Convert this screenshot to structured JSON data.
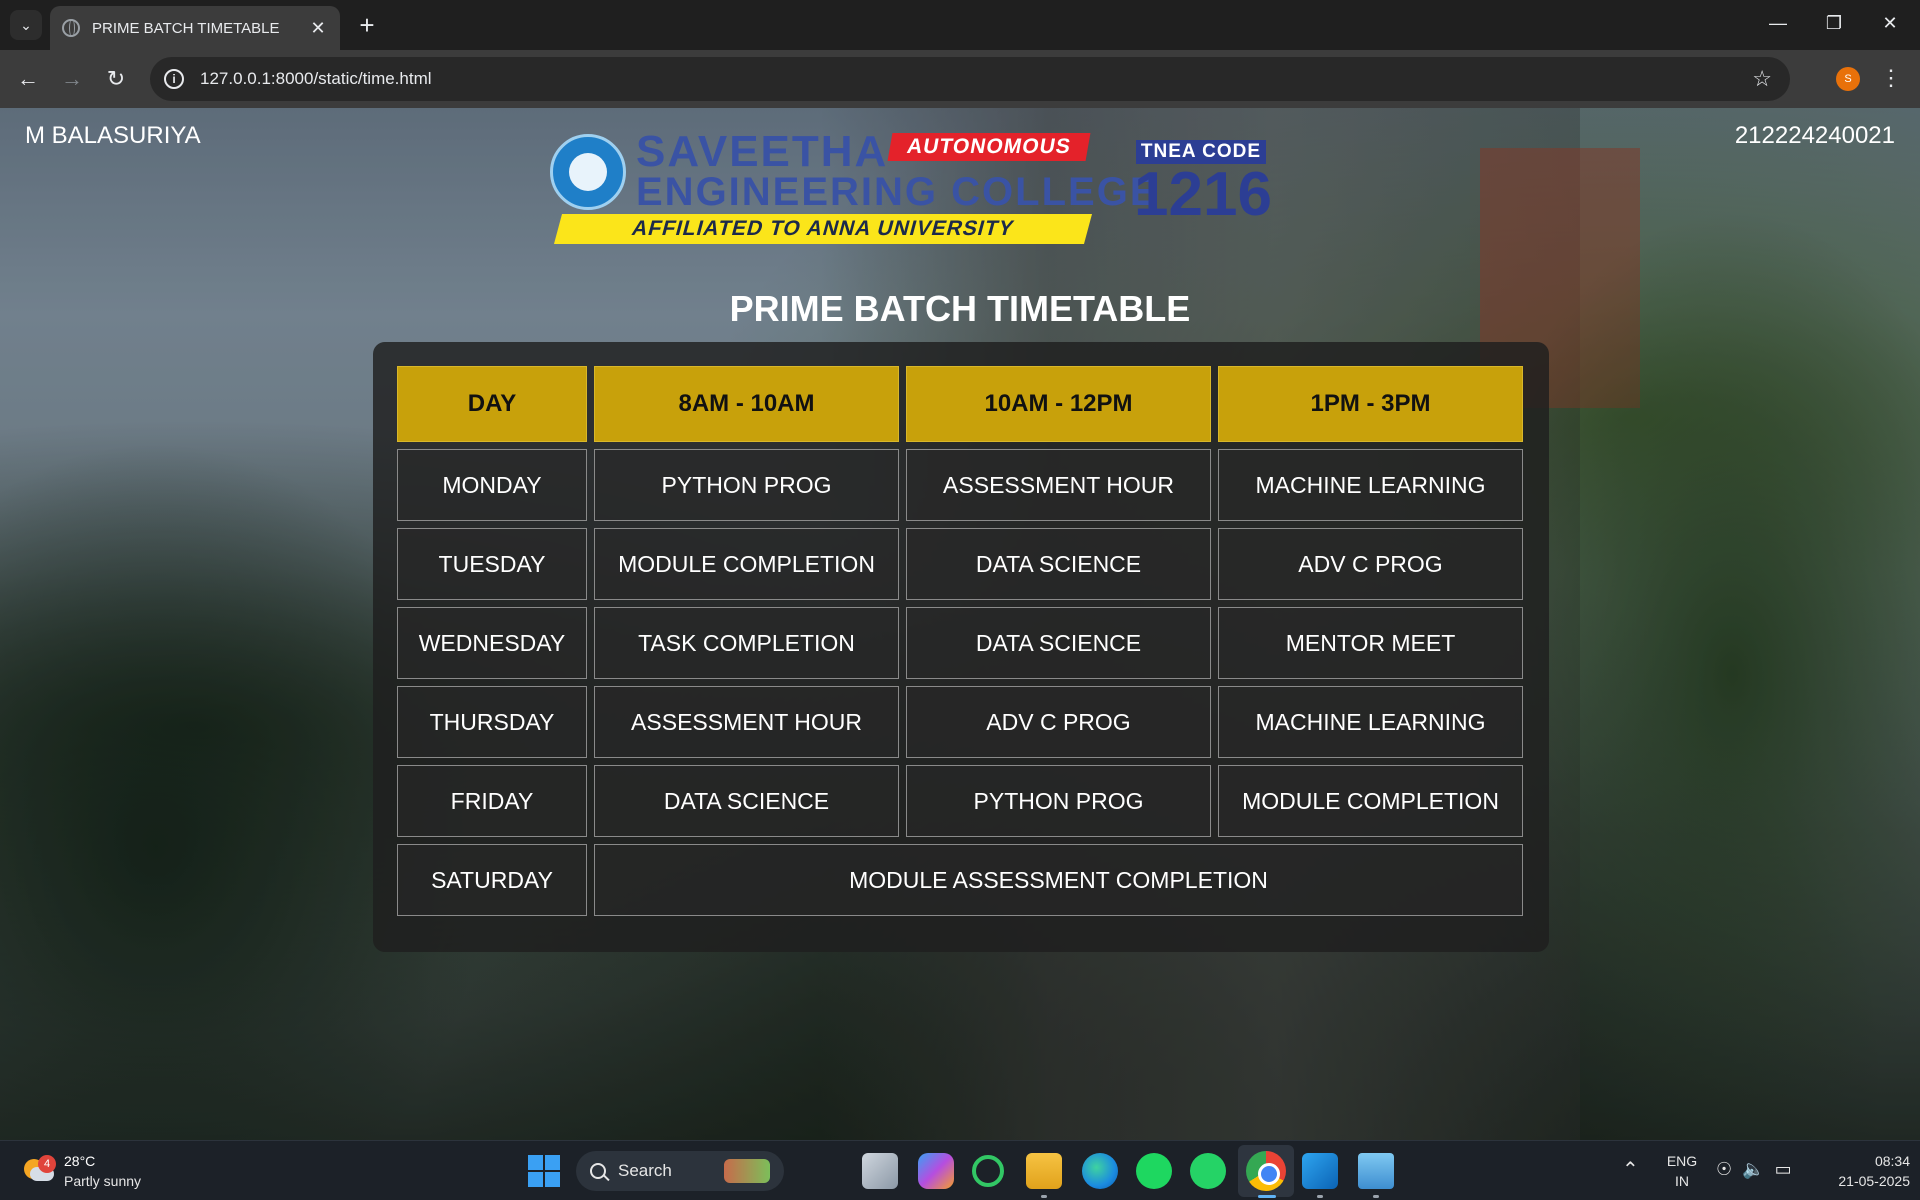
{
  "browser": {
    "tab_title": "PRIME BATCH TIMETABLE",
    "tab_close": "✕",
    "new_tab": "+",
    "url": "127.0.0.1:8000/static/time.html",
    "profile_initial": "S"
  },
  "page": {
    "student_name": "M BALASURIYA",
    "student_id": "212224240021",
    "logo": {
      "line1": "SAVEETHA",
      "autonomous": "AUTONOMOUS",
      "line2": "ENGINEERING COLLEGE",
      "affiliated": "AFFILIATED TO ANNA UNIVERSITY",
      "tnea_label": "TNEA CODE",
      "tnea_code": "1216"
    },
    "title": "PRIME BATCH TIMETABLE",
    "timetable": {
      "headers": [
        "DAY",
        "8AM - 10AM",
        "10AM - 12PM",
        "1PM - 3PM"
      ],
      "rows": [
        {
          "day": "MONDAY",
          "slots": [
            "PYTHON PROG",
            "ASSESSMENT HOUR",
            "MACHINE LEARNING"
          ]
        },
        {
          "day": "TUESDAY",
          "slots": [
            "MODULE COMPLETION",
            "DATA SCIENCE",
            "ADV C PROG"
          ]
        },
        {
          "day": "WEDNESDAY",
          "slots": [
            "TASK COMPLETION",
            "DATA SCIENCE",
            "MENTOR MEET"
          ]
        },
        {
          "day": "THURSDAY",
          "slots": [
            "ASSESSMENT HOUR",
            "ADV C PROG",
            "MACHINE LEARNING"
          ]
        },
        {
          "day": "FRIDAY",
          "slots": [
            "DATA SCIENCE",
            "PYTHON PROG",
            "MODULE COMPLETION"
          ]
        },
        {
          "day": "SATURDAY",
          "slots": [
            "MODULE ASSESSMENT COMPLETION"
          ]
        }
      ]
    }
  },
  "taskbar": {
    "weather_badge": "4",
    "weather_temp": "28°C",
    "weather_desc": "Partly sunny",
    "search_label": "Search",
    "lang_line1": "ENG",
    "lang_line2": "IN",
    "time": "08:34",
    "date": "21-05-2025"
  },
  "colors": {
    "header_gold": "#c8a10b",
    "logo_blue": "#3a53a4",
    "autonomous_red": "#e4222a",
    "affiliated_yellow": "#fbe51a"
  }
}
